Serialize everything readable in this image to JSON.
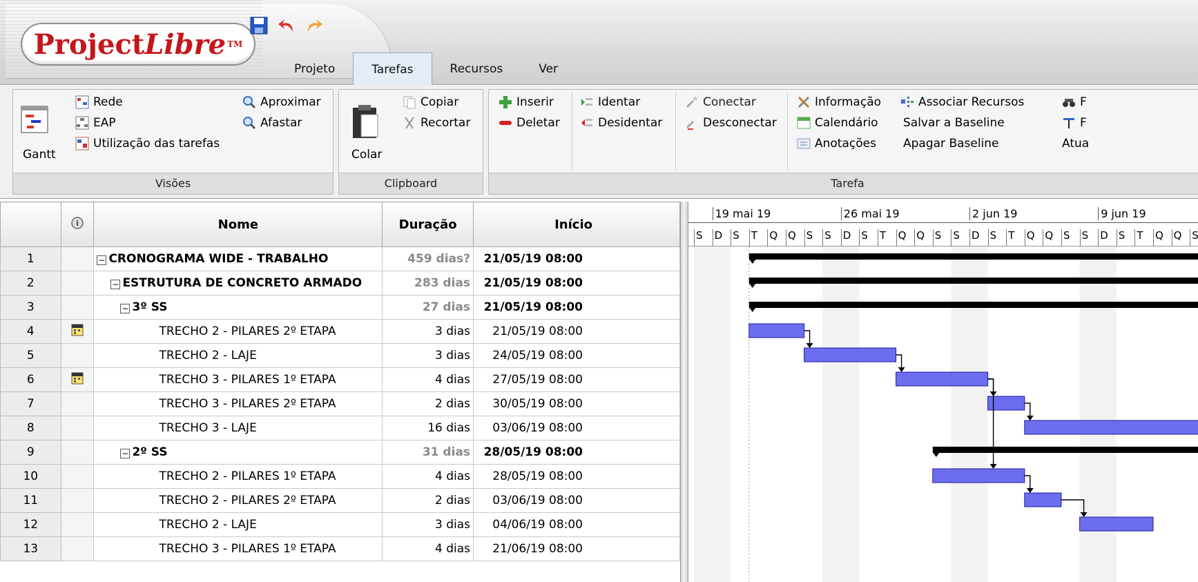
{
  "app": {
    "logo_brand": "Project",
    "logo_brand_italic": "Libre",
    "logo_tm": "TM",
    "tabs": [
      {
        "label": "Projeto",
        "active": false
      },
      {
        "label": "Tarefas",
        "active": true
      },
      {
        "label": "Recursos",
        "active": false
      },
      {
        "label": "Ver",
        "active": false
      }
    ]
  },
  "ribbon": {
    "visoes": {
      "title": "Visões",
      "gantt": "Gantt",
      "rede": "Rede",
      "eap": "EAP",
      "utilizacao": "Utilização das tarefas",
      "aproximar": "Aproximar",
      "afastar": "Afastar"
    },
    "clipboard": {
      "title": "Clipboard",
      "colar": "Colar",
      "copiar": "Copiar",
      "recortar": "Recortar"
    },
    "tarefa": {
      "title": "Tarefa",
      "inserir": "Inserir",
      "deletar": "Deletar",
      "identar": "Identar",
      "desidentar": "Desidentar",
      "conectar": "Conectar",
      "desconectar": "Desconectar",
      "informacao": "Informação",
      "calendario": "Calendário",
      "anotacoes": "Anotações",
      "associar": "Associar Recursos",
      "salvar_baseline": "Salvar a Baseline",
      "apagar_baseline": "Apagar Baseline",
      "cut_r1": "F",
      "cut_r2": "F",
      "cut_r3": "Atua"
    }
  },
  "grid": {
    "headers": {
      "nome": "Nome",
      "duracao": "Duração",
      "inicio": "Início"
    },
    "rows": [
      {
        "id": "1",
        "name": "CRONOGRAMA WIDE - TRABALHO",
        "dur": "459 dias?",
        "start": "21/05/19 08:00",
        "summary": true,
        "level": 0,
        "icon": false
      },
      {
        "id": "2",
        "name": "ESTRUTURA DE CONCRETO ARMADO",
        "dur": "283 dias",
        "start": "21/05/19 08:00",
        "summary": true,
        "level": 1,
        "icon": false
      },
      {
        "id": "3",
        "name": "3º SS",
        "dur": "27 dias",
        "start": "21/05/19 08:00",
        "summary": true,
        "level": 2,
        "icon": false
      },
      {
        "id": "4",
        "name": "TRECHO 2 - PILARES 2º ETAPA",
        "dur": "3 dias",
        "start": "21/05/19 08:00",
        "summary": false,
        "level": 3,
        "icon": true
      },
      {
        "id": "5",
        "name": "TRECHO 2 - LAJE",
        "dur": "3 dias",
        "start": "24/05/19 08:00",
        "summary": false,
        "level": 3,
        "icon": false
      },
      {
        "id": "6",
        "name": "TRECHO 3 - PILARES 1º ETAPA",
        "dur": "4 dias",
        "start": "27/05/19 08:00",
        "summary": false,
        "level": 3,
        "icon": true
      },
      {
        "id": "7",
        "name": "TRECHO 3 - PILARES 2º ETAPA",
        "dur": "2 dias",
        "start": "30/05/19 08:00",
        "summary": false,
        "level": 3,
        "icon": false
      },
      {
        "id": "8",
        "name": "TRECHO 3 - LAJE",
        "dur": "16 dias",
        "start": "03/06/19 08:00",
        "summary": false,
        "level": 3,
        "icon": false
      },
      {
        "id": "9",
        "name": "2º SS",
        "dur": "31 dias",
        "start": "28/05/19 08:00",
        "summary": true,
        "level": 2,
        "icon": false
      },
      {
        "id": "10",
        "name": "TRECHO 2 - PILARES 1º ETAPA",
        "dur": "4 dias",
        "start": "28/05/19 08:00",
        "summary": false,
        "level": 3,
        "icon": false
      },
      {
        "id": "11",
        "name": "TRECHO 2 - PILARES 2º ETAPA",
        "dur": "2 dias",
        "start": "03/06/19 08:00",
        "summary": false,
        "level": 3,
        "icon": false
      },
      {
        "id": "12",
        "name": "TRECHO 2 - LAJE",
        "dur": "3 dias",
        "start": "04/06/19 08:00",
        "summary": false,
        "level": 3,
        "icon": false
      },
      {
        "id": "13",
        "name": "TRECHO 3 - PILARES 1º ETAPA",
        "dur": "4 dias",
        "start": "21/06/19 08:00",
        "summary": false,
        "level": 3,
        "icon": false
      }
    ]
  },
  "gantt": {
    "weeks": [
      "19 mai 19",
      "26 mai 19",
      "2 jun 19",
      "9 jun 19"
    ],
    "first_day_letter": "S",
    "day_letters": [
      "D",
      "S",
      "T",
      "Q",
      "Q",
      "S",
      "S"
    ],
    "colors": {
      "task": "#6d6df0",
      "summary": "#000000",
      "weekend": "#e8e8e8"
    },
    "timeline_start": "2019-05-18",
    "bars": [
      {
        "row": 1,
        "type": "summary",
        "start": "2019-05-21",
        "end": null
      },
      {
        "row": 2,
        "type": "summary",
        "start": "2019-05-21",
        "end": null
      },
      {
        "row": 3,
        "type": "summary",
        "start": "2019-05-21",
        "end": null
      },
      {
        "row": 4,
        "type": "task",
        "start": "2019-05-21",
        "end": "2019-05-24"
      },
      {
        "row": 5,
        "type": "task",
        "start": "2019-05-24",
        "end": "2019-05-29"
      },
      {
        "row": 6,
        "type": "task",
        "start": "2019-05-29",
        "end": "2019-06-03"
      },
      {
        "row": 7,
        "type": "task",
        "start": "2019-06-03",
        "end": "2019-06-05"
      },
      {
        "row": 8,
        "type": "task",
        "start": "2019-06-05",
        "end": null
      },
      {
        "row": 9,
        "type": "summary",
        "start": "2019-05-31",
        "end": null
      },
      {
        "row": 10,
        "type": "task",
        "start": "2019-05-31",
        "end": "2019-06-05"
      },
      {
        "row": 11,
        "type": "task",
        "start": "2019-06-05",
        "end": "2019-06-07"
      },
      {
        "row": 12,
        "type": "task",
        "start": "2019-06-08",
        "end": "2019-06-12"
      }
    ],
    "links": [
      [
        4,
        5
      ],
      [
        5,
        6
      ],
      [
        6,
        7
      ],
      [
        7,
        8
      ],
      [
        6,
        10
      ],
      [
        10,
        11
      ],
      [
        11,
        12
      ]
    ]
  }
}
